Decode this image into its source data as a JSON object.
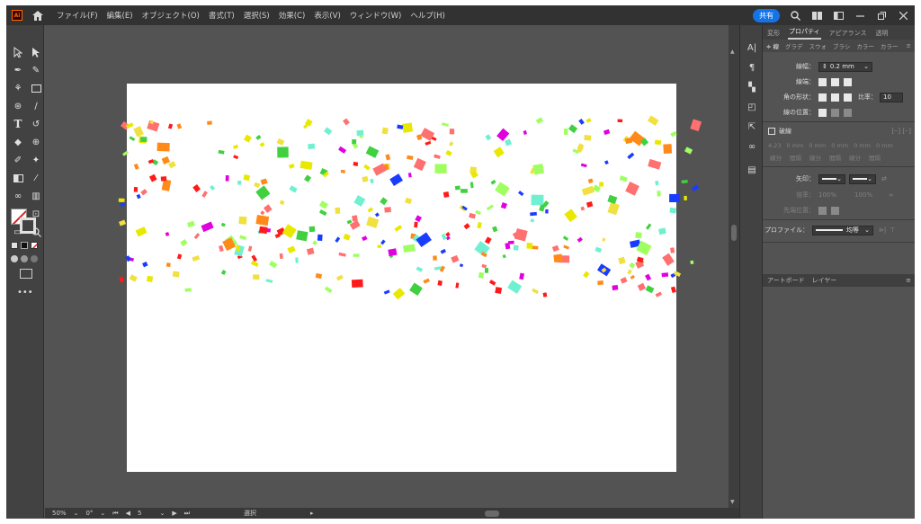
{
  "menu": {
    "items": [
      "ファイル(F)",
      "編集(E)",
      "オブジェクト(O)",
      "書式(T)",
      "選択(S)",
      "効果(C)",
      "表示(V)",
      "ウィンドウ(W)",
      "ヘルプ(H)"
    ],
    "share_label": "共有",
    "logo_text": "Ai"
  },
  "status": {
    "zoom": "50%",
    "rotation": "0°",
    "artboard_number": "5",
    "tool_name": "選択"
  },
  "panel": {
    "tabs": [
      "変形",
      "プロパティ",
      "アピアランス",
      "透明"
    ],
    "active_tab": "プロパティ",
    "subtabs": [
      "グラデ",
      "スウォ",
      "ブラシ",
      "カラー",
      "カラー"
    ],
    "stroke_width_label": "線幅：",
    "stroke_width_value": "0.2 mm",
    "cap_label": "線端：",
    "corner_label": "角の形状：",
    "ratio_label": "比率：",
    "ratio_value": "10",
    "align_label": "線の位置：",
    "dashed_label": "破線",
    "dash_values": [
      "4.23",
      "0 mm",
      "0 mm",
      "0 mm",
      "0 mm",
      "0 mm"
    ],
    "dash_labels": [
      "線分",
      "間隔",
      "線分",
      "間隔",
      "線分",
      "間隔"
    ],
    "arrow_label": "矢印：",
    "scale_label": "倍率：",
    "scale_values": [
      "100%",
      "100%"
    ],
    "tip_label": "先端位置：",
    "profile_label": "プロファイル：",
    "profile_value": "均等",
    "bottom_tabs": [
      "アートボード",
      "レイヤー"
    ]
  },
  "colors": {
    "app_bg": "#535353",
    "menubar": "#323232",
    "accent": "#1473e6",
    "confetti": [
      "#e8e800",
      "#40d040",
      "#ff8a1a",
      "#e000e0",
      "#1a3cff",
      "#ff1a1a",
      "#f0e040",
      "#70f0d0",
      "#ff7070",
      "#a0ff60"
    ]
  },
  "icons": [
    "home-icon",
    "search-icon",
    "minimize-icon",
    "maximize-icon",
    "close-icon",
    "selection-tool-icon",
    "pen-tool-icon",
    "type-tool-icon",
    "zoom-tool-icon",
    "fill-stroke-icon"
  ]
}
